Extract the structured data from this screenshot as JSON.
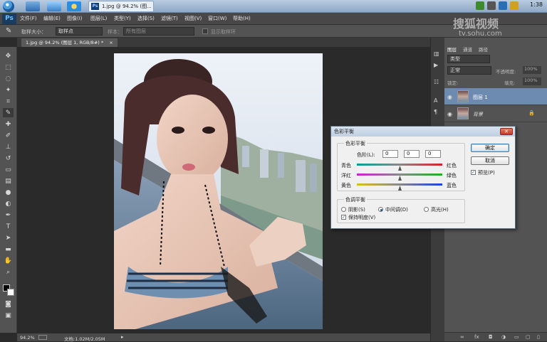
{
  "taskbar": {
    "active_window_label": "1.jpg @ 94.2% (图...",
    "clock": "1:38"
  },
  "menubar": {
    "logo": "Ps",
    "items": [
      "文件(F)",
      "编辑(E)",
      "图像(I)",
      "图层(L)",
      "类型(Y)",
      "选择(S)",
      "滤镜(T)",
      "视图(V)",
      "窗口(W)",
      "帮助(H)"
    ]
  },
  "options": {
    "sample_size_label": "取样大小：",
    "sample_size_value": "取样点",
    "sample_label": "样本：",
    "sample_value": "所有图层",
    "show_ring_label": "显示取样环"
  },
  "document": {
    "tab_label": "1.jpg @ 94.2% (图层 1, RGB/8#) *",
    "tab_close": "×"
  },
  "status": {
    "zoom": "94.2%",
    "doc_size": "文档:1.02M/2.05M"
  },
  "layers_panel": {
    "tabs": [
      "图层",
      "通道",
      "路径"
    ],
    "kind_label": "类型",
    "blend_mode": "正常",
    "opacity_label": "不透明度:",
    "opacity_value": "100%",
    "lock_label": "锁定:",
    "fill_label": "填充:",
    "fill_value": "100%",
    "layers": [
      {
        "name": "图层 1",
        "selected": true
      },
      {
        "name": "背景",
        "selected": false
      }
    ]
  },
  "dialog": {
    "title": "色彩平衡",
    "close": "✕",
    "balance_group": "色彩平衡",
    "levels_label": "色阶(L):",
    "levels": [
      "0",
      "0",
      "0"
    ],
    "sliders": [
      {
        "left": "青色",
        "right": "红色",
        "left_color": "#00a0a0",
        "right_color": "#e02020",
        "position": 0.5
      },
      {
        "left": "洋红",
        "right": "绿色",
        "left_color": "#d020d0",
        "right_color": "#20b020",
        "position": 0.5
      },
      {
        "left": "黄色",
        "right": "蓝色",
        "left_color": "#d8c020",
        "right_color": "#2040e0",
        "position": 0.5
      }
    ],
    "tone_group": "色调平衡",
    "tones": [
      {
        "label": "阴影(S)",
        "checked": false
      },
      {
        "label": "中间调(D)",
        "checked": true
      },
      {
        "label": "高光(H)",
        "checked": false
      }
    ],
    "preserve_luminosity": "保持明度(V)",
    "ok": "确定",
    "cancel": "取消",
    "preview": "预览(P)"
  },
  "watermark": {
    "title": "搜狐视频",
    "url": "tv.sohu.com"
  }
}
